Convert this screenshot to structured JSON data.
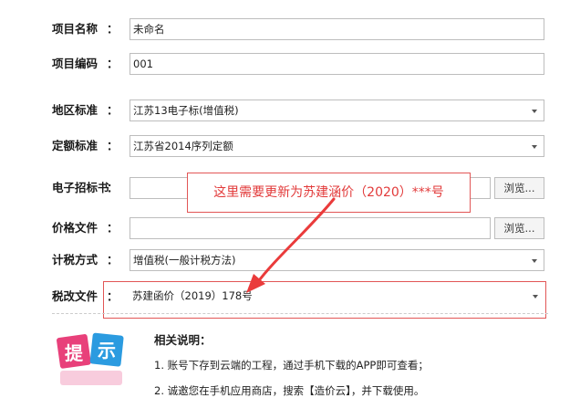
{
  "form": {
    "project_name": {
      "label": "项目名称",
      "colon": "：",
      "value": "未命名"
    },
    "project_code": {
      "label": "项目编码",
      "colon": "：",
      "value": "001"
    },
    "region_standard": {
      "label": "地区标准",
      "colon": "：",
      "value": "江苏13电子标(增值税)"
    },
    "quota_standard": {
      "label": "定额标准",
      "colon": "：",
      "value": "江苏省2014序列定额"
    },
    "tender_file": {
      "label": "电子招标书",
      "colon": "：",
      "value": "",
      "browse_label": "浏览..."
    },
    "price_file": {
      "label": "价格文件",
      "colon": "：",
      "value": "",
      "browse_label": "浏览..."
    },
    "tax_method": {
      "label": "计税方式",
      "colon": "：",
      "value": "增值税(一般计税方法)"
    },
    "tax_reform_file": {
      "label": "税改文件",
      "colon": "：",
      "value": "苏建函价（2019）178号"
    }
  },
  "annotation": {
    "callout_text": "这里需要更新为苏建涵价（2020）***号",
    "color": "#e23a3a"
  },
  "tip": {
    "badge_chars": [
      "提",
      "示"
    ],
    "title": "相关说明：",
    "notes": [
      "1. 账号下存到云端的工程，通过手机下载的APP即可查看；",
      "2. 诚邀您在手机应用商店，搜索【造价云】，并下载使用。"
    ]
  }
}
